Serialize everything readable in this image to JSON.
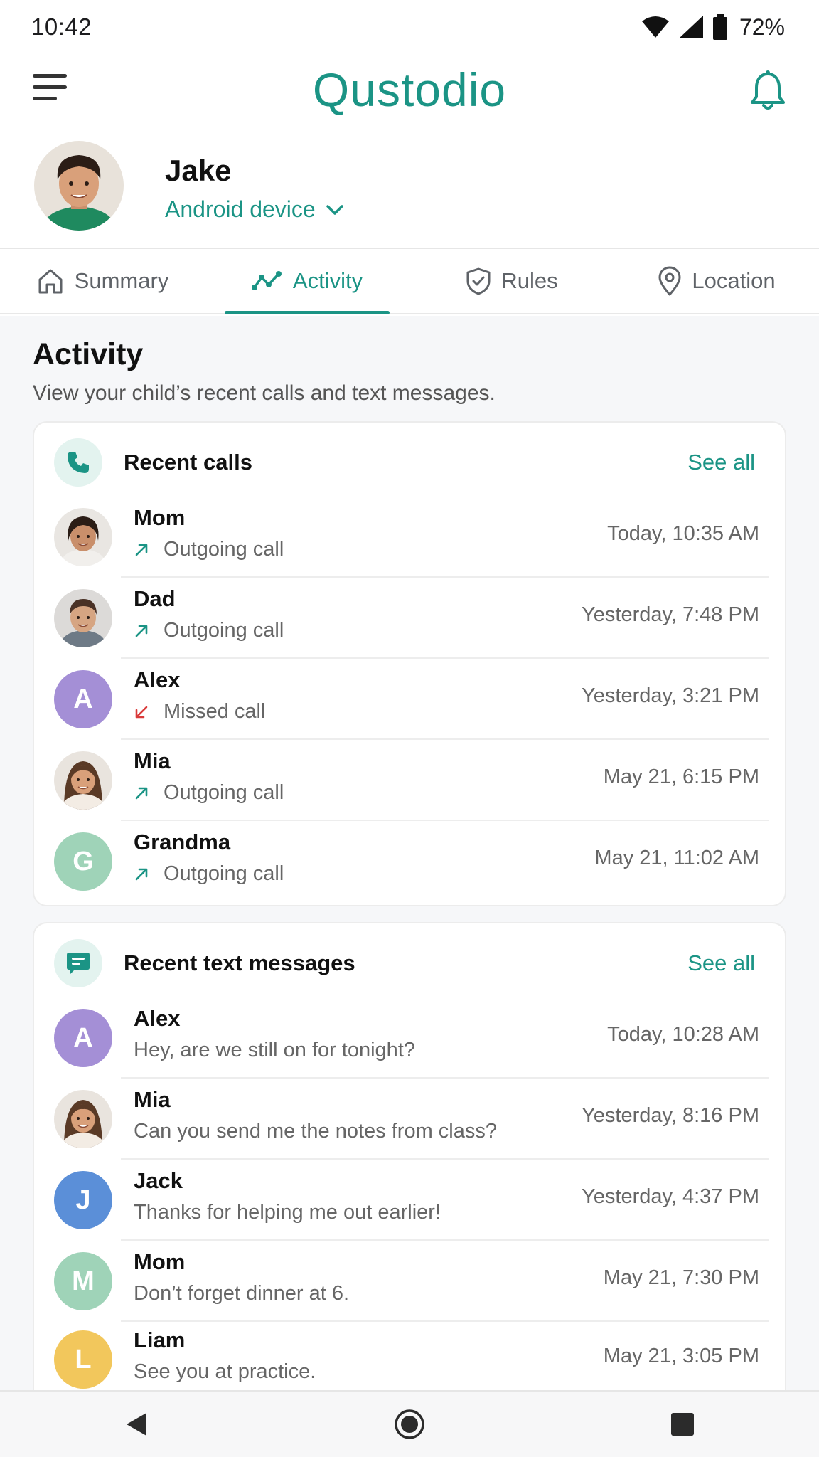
{
  "status_bar": {
    "time": "10:42",
    "battery": "72%"
  },
  "header": {
    "logo": "Qustodio"
  },
  "profile": {
    "name": "Jake",
    "device": "Android device"
  },
  "tabs": [
    {
      "label": "Summary",
      "icon": "home-icon"
    },
    {
      "label": "Activity",
      "icon": "activity-icon",
      "active": true
    },
    {
      "label": "Rules",
      "icon": "shield-icon"
    },
    {
      "label": "Location",
      "icon": "location-pin-icon"
    }
  ],
  "activity": {
    "title": "Activity",
    "subtitle": "View your child’s recent calls and text messages."
  },
  "calls": {
    "title": "Recent calls",
    "see_all": "See all",
    "items": [
      {
        "name": "Mom",
        "type": "Outgoing call",
        "direction": "outgoing",
        "time": "Today, 10:35 AM",
        "avatar": "photo"
      },
      {
        "name": "Dad",
        "type": "Outgoing call",
        "direction": "outgoing",
        "time": "Yesterday, 7:48 PM",
        "avatar": "photo"
      },
      {
        "name": "Alex",
        "type": "Missed call",
        "direction": "missed",
        "time": "Yesterday, 3:21 PM",
        "initial": "A",
        "color": "#a48fd6"
      },
      {
        "name": "Mia",
        "type": "Outgoing call",
        "direction": "outgoing",
        "time": "May 21, 6:15 PM",
        "avatar": "photo"
      },
      {
        "name": "Grandma",
        "type": "Outgoing call",
        "direction": "outgoing",
        "time": "May 21, 11:02 AM",
        "initial": "G",
        "color": "#9fd3b8"
      }
    ]
  },
  "texts": {
    "title": "Recent text messages",
    "see_all": "See all",
    "items": [
      {
        "name": "Alex",
        "message": "Hey, are we still on for tonight?",
        "time": "Today, 10:28 AM",
        "initial": "A",
        "color": "#a48fd6"
      },
      {
        "name": "Mia",
        "message": "Can you send me the notes from class?",
        "time": "Yesterday, 8:16 PM",
        "avatar": "photo"
      },
      {
        "name": "Jack",
        "message": "Thanks for helping me out earlier!",
        "time": "Yesterday, 4:37 PM",
        "initial": "J",
        "color": "#5b8fd8"
      },
      {
        "name": "Mom",
        "message": "Don’t forget dinner at 6.",
        "time": "May 21, 7:30 PM",
        "initial": "M",
        "color": "#9fd3b8"
      },
      {
        "name": "Liam",
        "message": "See you at practice.",
        "time": "May 21, 3:05 PM",
        "initial": "L",
        "color": "#f2c75c"
      }
    ]
  },
  "colors": {
    "brand": "#1b9485",
    "outgoing": "#1b9485",
    "missed": "#d93a3a"
  }
}
